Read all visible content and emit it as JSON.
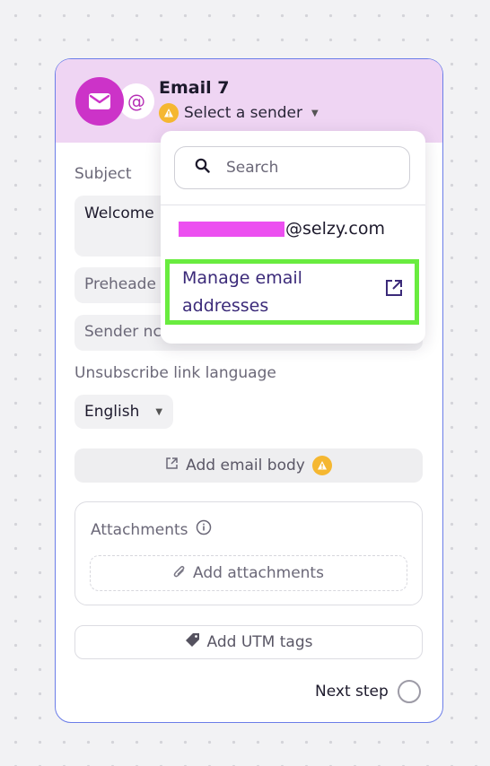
{
  "card": {
    "title": "Email 7",
    "sender_label": "Select a sender",
    "at_symbol": "@"
  },
  "form": {
    "subject_label": "Subject",
    "subject_value": "Welcome",
    "preheader_placeholder": "Preheade",
    "sender_name_placeholder": "Sender nc",
    "unsubscribe_label": "Unsubscribe link language",
    "language_value": "English",
    "add_body_label": "Add email body",
    "attachments_label": "Attachments",
    "add_attachments_label": "Add attachments",
    "add_utm_label": "Add UTM tags",
    "next_step_label": "Next step"
  },
  "dropdown": {
    "search_placeholder": "Search",
    "email_domain": "@selzy.com",
    "manage_label": "Manage email addresses"
  },
  "colors": {
    "header_bg": "#efd5f3",
    "brand_magenta": "#cc33c8",
    "card_border": "#6b7de8",
    "warning": "#f5b731",
    "highlight_green": "#69ec3f",
    "link_purple": "#3b2a79",
    "redaction": "#ec4ff0"
  },
  "icons": [
    "mail-icon",
    "at-icon",
    "warning-icon",
    "chevron-down-icon",
    "search-icon",
    "external-link-icon",
    "paperclip-icon",
    "info-icon",
    "tag-icon"
  ]
}
